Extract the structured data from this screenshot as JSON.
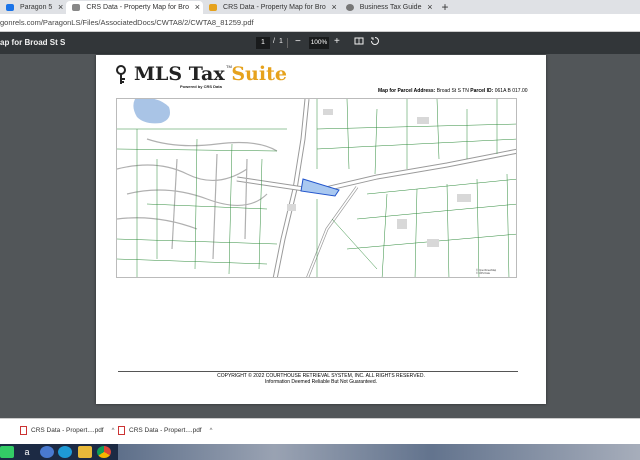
{
  "browser": {
    "tabs": [
      {
        "label": "Paragon 5",
        "favicon": "paragon-icon",
        "color": "#1a73e8"
      },
      {
        "label": "CRS Data - Property Map for Bro",
        "favicon": "cloud-icon",
        "color": "#888888",
        "active": true
      },
      {
        "label": "CRS Data - Property Map for Bro",
        "favicon": "crs-icon",
        "color": "#e6a21c"
      },
      {
        "label": "Business Tax Guide",
        "favicon": "globe-icon",
        "color": "#777777"
      }
    ],
    "tab_close": "×",
    "new_tab": "+",
    "url": "gonrels.com/ParagonLS/Files/AssociatedDocs/CWTA8/2/CWTA8_81259.pdf"
  },
  "pdf_toolbar": {
    "title": "ap for Broad St S",
    "page_current": "1",
    "page_sep": "/",
    "page_total": "1",
    "zoom_out": "−",
    "zoom": "100%",
    "zoom_in": "+",
    "fit_icon": "fit-page-icon",
    "rotate_icon": "rotate-icon"
  },
  "pdf": {
    "logo_main": "MLS Tax ",
    "logo_suite": "Suite",
    "logo_tm": "TM",
    "logo_sub": "Powered by CRS Data",
    "map_title_label": "Map for Parcel Address:",
    "map_title_addr": " Broad St S TN ",
    "map_parcel_label": "Parcel ID:",
    "map_parcel_id": " 061A B 017.00",
    "map_legend_1": "© OpenStreetMap",
    "map_legend_2": "© CRS Data",
    "copyright": "COPYRIGHT © 2022 COURTHOUSE RETRIEVAL SYSTEM, INC. ALL RIGHTS RESERVED.",
    "disclaimer": "Information Deemed Reliable But Not Guaranteed."
  },
  "downloads": [
    {
      "label": "CRS Data - Propert....pdf",
      "caret": "^"
    },
    {
      "label": "CRS Data - Propert....pdf",
      "caret": "^"
    }
  ],
  "colors": {
    "accent_suite": "#e6a21c",
    "parcel_fill": "#a9c8f0",
    "parcel_stroke": "#2255cc",
    "parcel_lines": "#2e8b3a"
  }
}
